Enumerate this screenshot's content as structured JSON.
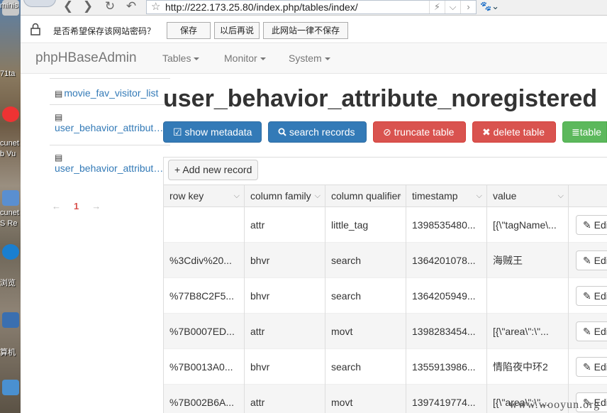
{
  "desktop": {
    "labels": [
      "minis",
      "71ta",
      "cunet",
      "b Vu",
      "cunet",
      "S Re",
      "浏览",
      "算机"
    ]
  },
  "browser": {
    "url": "http://222.173.25.80/index.php/tables/index/",
    "back_glyph": "❮",
    "forward_glyph": "❯",
    "refresh_glyph": "↻",
    "undo_glyph": "↶",
    "star_glyph": "☆"
  },
  "password_bar": {
    "prompt": "是否希望保存该网站密码？",
    "save": "保存",
    "later": "以后再说",
    "never": "此网站一律不保存"
  },
  "navbar": {
    "brand": "phpHBaseAdmin",
    "menus": [
      "Tables",
      "Monitor",
      "System"
    ]
  },
  "sidebar": {
    "items": [
      {
        "label": "movie_fav_visitor_list"
      },
      {
        "label": "user_behavior_attribute_noregistered"
      },
      {
        "label": "user_behavior_attribute_registered"
      }
    ],
    "pager": {
      "prev": "←",
      "current": "1",
      "next": "→"
    }
  },
  "main": {
    "title": "user_behavior_attribute_noregistered",
    "actions": {
      "show_metadata": "show metadata",
      "search_records": "search records",
      "truncate_table": "truncate table",
      "delete_table": "delete table",
      "table_more": "table"
    },
    "add_record": "Add new record",
    "columns": [
      "row key",
      "column family",
      "column qualifier",
      "timestamp",
      "value"
    ],
    "rows": [
      {
        "row_key": "",
        "family": "attr",
        "qualifier": "little_tag",
        "timestamp": "1398535480...",
        "value": "[{\\\"tagName\\..."
      },
      {
        "row_key": "%3Cdiv%20...",
        "family": "bhvr",
        "qualifier": "search",
        "timestamp": "1364201078...",
        "value": "海贼王"
      },
      {
        "row_key": "%77B8C2F5...",
        "family": "bhvr",
        "qualifier": "search",
        "timestamp": "1364205949...",
        "value": ""
      },
      {
        "row_key": "%7B0007ED...",
        "family": "attr",
        "qualifier": "movt",
        "timestamp": "1398283454...",
        "value": "[{\\\"area\\\":\\\"..."
      },
      {
        "row_key": "%7B0013A0...",
        "family": "bhvr",
        "qualifier": "search",
        "timestamp": "1355913986...",
        "value": "情陷夜中环2"
      },
      {
        "row_key": "%7B002B6A...",
        "family": "attr",
        "qualifier": "movt",
        "timestamp": "1397419774...",
        "value": "[{\\\"area\\\":\\\"..."
      }
    ],
    "edit_label": "Edit"
  },
  "watermark": "www.wooyun.org",
  "colors": {
    "primary": "#337ab7",
    "danger": "#d9534f",
    "success": "#5cb85c"
  }
}
